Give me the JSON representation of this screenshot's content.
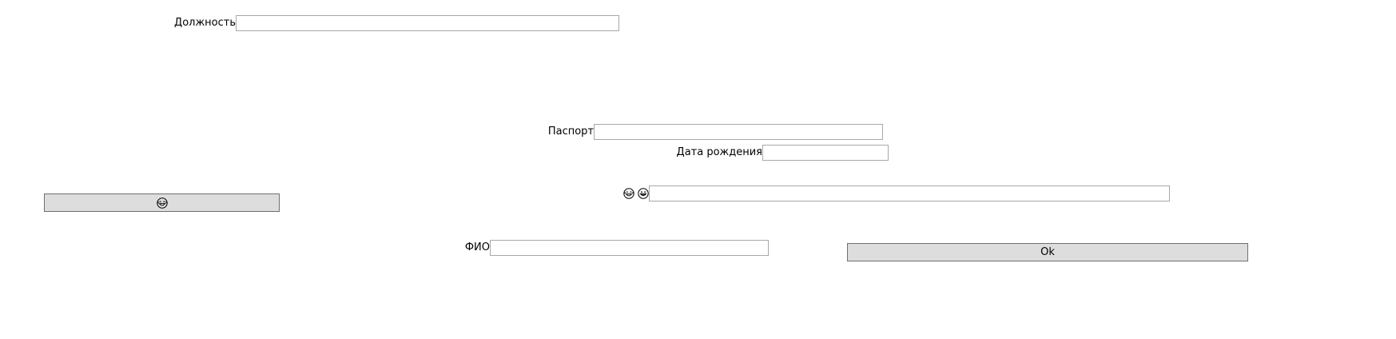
{
  "form": {
    "position_label": "Должность",
    "position_value": "",
    "passport_label": "Паспорт",
    "passport_value": "",
    "birth_date_label": "Дата рождения",
    "birth_date_value": "",
    "emoji_field_value": "",
    "fio_label": "ФИО",
    "fio_value": "",
    "ok_button_label": "Ok"
  },
  "icons": {
    "left_button_icon": "laughing-face-icon",
    "label_icon_1": "laughing-face-icon",
    "label_icon_2": "grinning-face-icon"
  }
}
